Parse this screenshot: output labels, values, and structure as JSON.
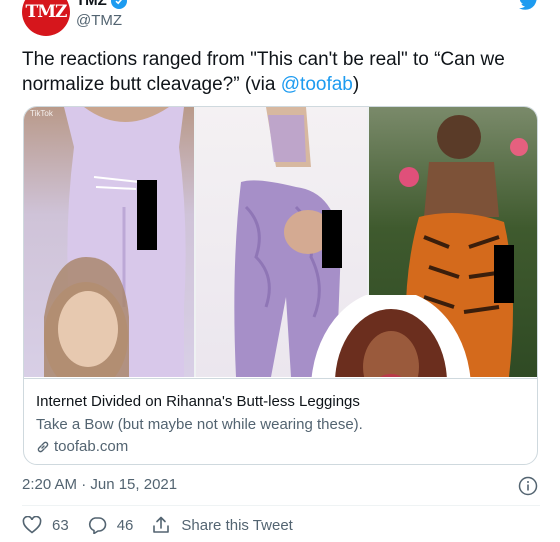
{
  "account": {
    "avatar_text": "TMZ",
    "display_name": "TMZ",
    "handle": "@TMZ",
    "verified": true,
    "brand_color": "#d6161c"
  },
  "tweet": {
    "text_before_link": "The reactions ranged from \"This can't be real\" to “Can we normalize butt cleavage?” (via ",
    "link_text": "@toofab",
    "text_after_link": ")",
    "link_color": "#1d9bf0"
  },
  "card": {
    "tiktok_watermark": "TikTok",
    "title": "Internet Divided on Rihanna's Butt-less Leggings",
    "description": "Take a Bow (but maybe not while wearing these).",
    "domain": "toofab.com"
  },
  "meta": {
    "timestamp": "2:20 AM · Jun 15, 2021"
  },
  "actions": {
    "likes": "63",
    "replies": "46",
    "share_label": "Share this Tweet"
  },
  "icons": [
    "twitter-bird-icon",
    "verified-badge-icon",
    "link-icon",
    "info-icon",
    "heart-icon",
    "reply-icon",
    "share-icon"
  ]
}
